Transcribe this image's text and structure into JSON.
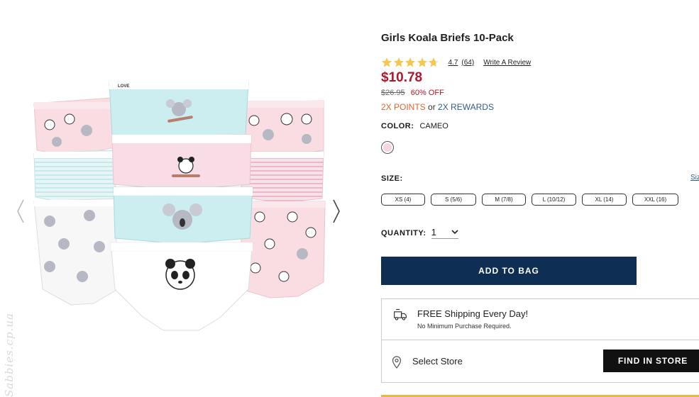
{
  "product": {
    "title": "Girls Koala Briefs 10-Pack",
    "rating": {
      "value": 4.7,
      "value_text": "4.7",
      "count_text": "(64)",
      "write_review": "Write A Review",
      "star_color": "#f2c94c"
    },
    "price": "$10.78",
    "original_price": "$26.95",
    "discount": "60% OFF",
    "points": "2X POINTS",
    "or_text": "or",
    "rewards": "2X REWARDS",
    "color": {
      "label": "COLOR:",
      "value": "CAMEO",
      "swatch_color": "#f4d7dd"
    },
    "size": {
      "label": "SIZE:",
      "chart_link": "Size",
      "options": [
        "XS (4)",
        "S (5/6)",
        "M (7/8)",
        "L (10/12)",
        "XL (14)",
        "XXL (16)"
      ]
    },
    "quantity": {
      "label": "QUANTITY:",
      "value": "1"
    },
    "add_to_bag": "ADD TO BAG",
    "shipping": {
      "title": "FREE Shipping Every Day!",
      "subtitle": "No Minimum Purchase Required."
    },
    "store": {
      "label": "Select Store",
      "button": "FIND IN STORE"
    }
  },
  "gallery": {
    "prev_icon": "chevron-left-icon",
    "next_icon": "chevron-right-icon",
    "band_text": "LOVE",
    "watermark": "Sabbies.cp.ua"
  },
  "colors": {
    "brand_navy": "#0e2e53",
    "price_red": "#b0172a",
    "points_orange": "#d9662b",
    "rewards_blue": "#2f5d8a"
  }
}
